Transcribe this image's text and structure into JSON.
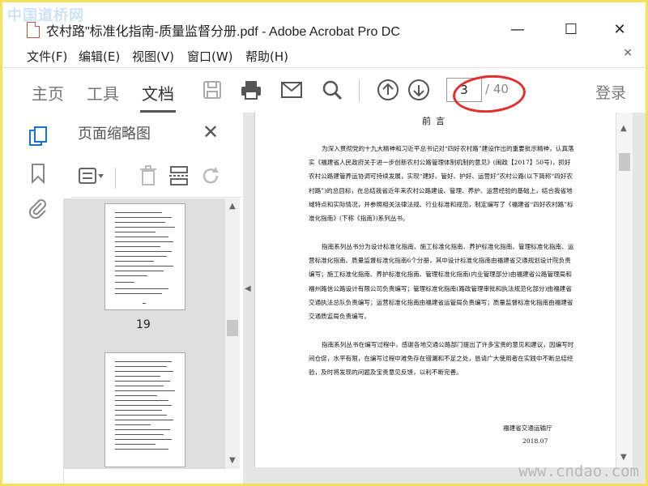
{
  "watermark_top": "中国道桥网",
  "watermark_bottom": "www.cndao.com",
  "window": {
    "title": "农村路\"标准化指南-质量监督分册.pdf - Adobe Acrobat Pro DC",
    "minimize": "—",
    "maximize": "☐",
    "close": "✕"
  },
  "menu": {
    "items": [
      "文件(F)",
      "编辑(E)",
      "视图(V)",
      "窗口(W)",
      "帮助(H)"
    ],
    "close": "×"
  },
  "toolbar": {
    "tabs": [
      "主页",
      "工具",
      "文档"
    ],
    "active_tab": "文档",
    "current_page": "3",
    "total_pages": "/ 40",
    "login": "登录",
    "icons": [
      "save-icon",
      "print-icon",
      "email-icon",
      "search-icon",
      "page-up-icon",
      "page-down-icon"
    ]
  },
  "sidebar": {
    "buttons": [
      "thumbnails-icon",
      "bookmark-icon",
      "attachment-icon"
    ]
  },
  "panel": {
    "title": "页面缩略图",
    "close": "✕",
    "thumb_label": "19"
  },
  "document": {
    "heading": "前言",
    "paragraphs": [
      "为深入贯彻党的十九大精神和习近平总书记对“四好农村路”建设作出的重要批示精神，认真落实《福建省人民政府关于进一步创新农村公路管理体制机制的意见》(闽政【2017】50号)，抓好农村公路建管养运协调可持续发展，实现“建好、管好、护好、运营好”农村公路(以下简称“四好农村路”)的总目标，在总结我省近年来农村公路建设、管理、养护、运营经验的基础上，结合我省地域特点和实际情况，并参照相关法律法规、行业标准和规范，制定编写了《福建省“四好农村路”标准化指南》(下称《指南》)系列丛书。",
      "指南系列丛书分为设计标准化指南、施工标准化指南、养护标准化指南、管理标准化指南、运营标准化指南、质量监督标准化指南6个分册，其中设计标准化指南由福建省交通规划设计院负责编写；施工标准化指南、养护标准化指南、管理标准化指南(内业管理部分)由福建省公路管理局和福州路信公路设计有限公司负责编写；管理标准化指南(路政管理审批和执法规范化部分)由福建省交通执法总队负责编写；运营标准化指南由福建省运管局负责编写；质量监督标准化指南由福建省交通质监局负责编写。",
      "指南系列丛书在编写过程中，感谢各地交通公路部门提出了许多宝贵的意见和建议，因编写时间仓促，水平有限，在编写过程中难免存在错漏和不足之处，恳请广大使用者在实践中不断总结经验，及时将发现的问题及宝贵意见反馈，以利不断完善。"
    ],
    "signature": "福建省交通运输厅",
    "date": "2018.07"
  }
}
